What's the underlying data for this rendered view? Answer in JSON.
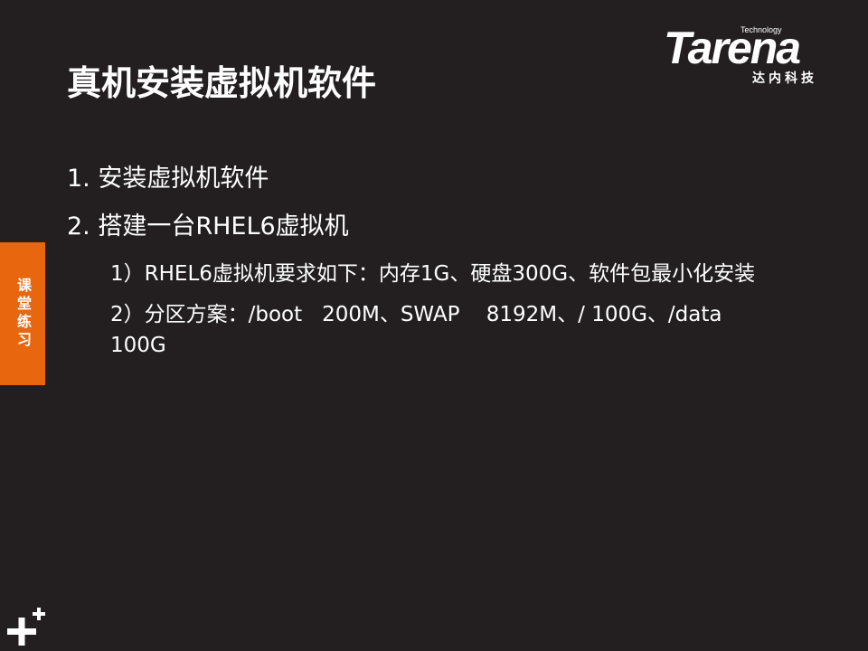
{
  "logo": {
    "tagline": "Technology",
    "wordmark": "Tarena",
    "chinese": "达内科技"
  },
  "title": "真机安装虚拟机软件",
  "side_tab": "课堂练习",
  "items": [
    {
      "text": "1. 安装虚拟机软件",
      "subitems": []
    },
    {
      "text": "2. 搭建一台RHEL6虚拟机",
      "subitems": [
        "1）RHEL6虚拟机要求如下：内存1G、硬盘300G、软件包最小化安装",
        "2）分区方案：/boot   200M、SWAP    8192M、/ 100G、/data    100G"
      ]
    }
  ],
  "colors": {
    "background": "#231f20",
    "accent": "#e8670e",
    "text": "#ffffff"
  }
}
